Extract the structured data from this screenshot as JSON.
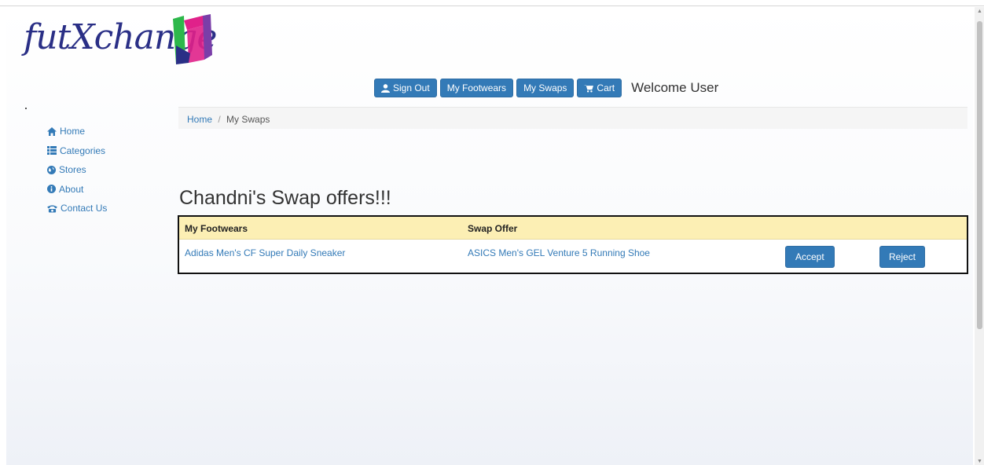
{
  "brand": {
    "name": "futXchange"
  },
  "topnav": {
    "sign_out": "Sign Out",
    "my_footwears": "My Footwears",
    "my_swaps": "My Swaps",
    "cart": "Cart",
    "welcome": "Welcome User"
  },
  "sidebar": {
    "items": [
      {
        "label": "Home",
        "icon": "home-icon"
      },
      {
        "label": "Categories",
        "icon": "list-icon"
      },
      {
        "label": "Stores",
        "icon": "globe-icon"
      },
      {
        "label": "About",
        "icon": "info-icon"
      },
      {
        "label": "Contact Us",
        "icon": "phone-icon"
      }
    ]
  },
  "breadcrumb": {
    "home": "Home",
    "separator": "/",
    "current": "My Swaps"
  },
  "main": {
    "heading": "Chandni's Swap offers!!!",
    "table": {
      "headers": [
        "My Footwears",
        "Swap Offer"
      ],
      "rows": [
        {
          "my_footwear": "Adidas Men's CF Super Daily Sneaker",
          "swap_offer": "ASICS Men's GEL Venture 5 Running Shoe",
          "accept": "Accept",
          "reject": "Reject"
        }
      ]
    }
  },
  "colors": {
    "primary": "#337ab7",
    "table_header": "#fcefb4",
    "logo_text": "#2a2f86"
  }
}
